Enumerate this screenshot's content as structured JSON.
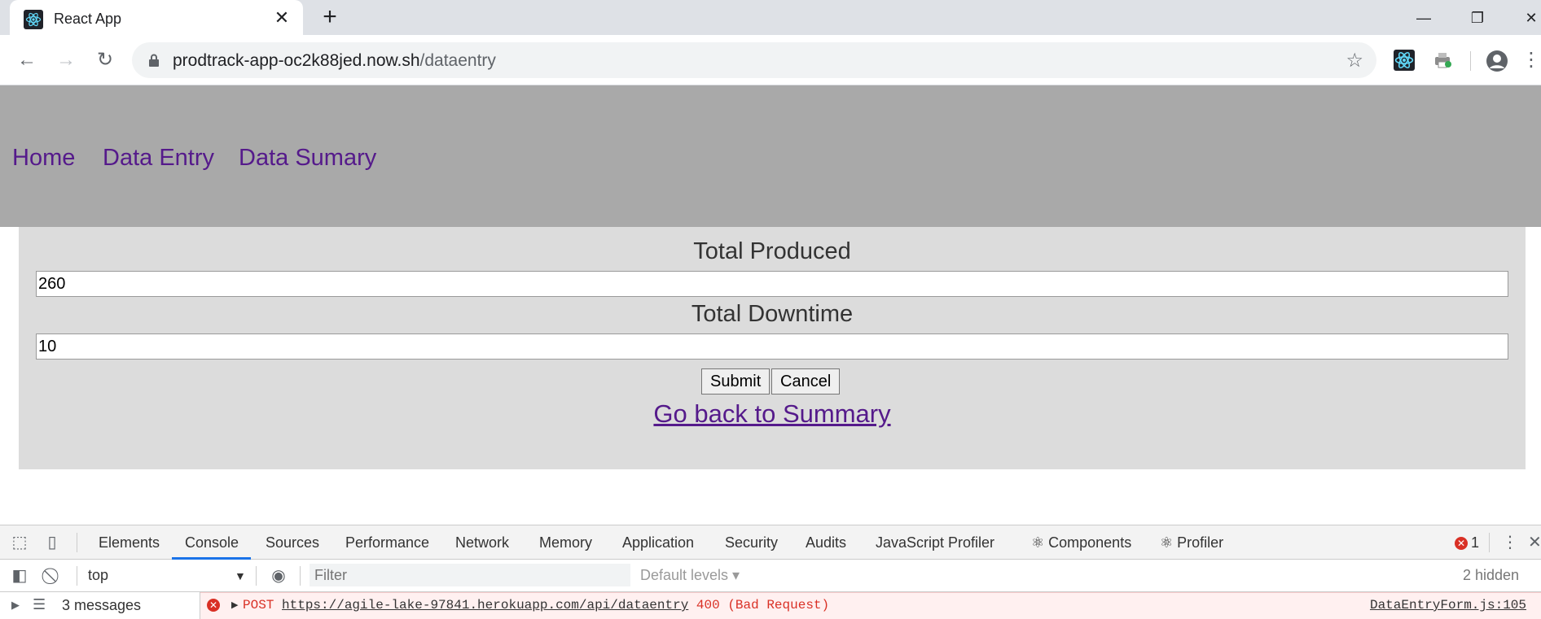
{
  "browser": {
    "tab_title": "React App",
    "url_host": "prodtrack-app-oc2k88jed.now.sh",
    "url_path": "/dataentry"
  },
  "nav": {
    "home": "Home",
    "data_entry": "Data Entry",
    "data_summary": "Data Sumary"
  },
  "form": {
    "total_produced_label": "Total Produced",
    "total_produced_value": "260",
    "total_downtime_label": "Total Downtime",
    "total_downtime_value": "10",
    "submit_label": "Submit",
    "cancel_label": "Cancel",
    "back_link": "Go back to Summary"
  },
  "devtools": {
    "tabs": [
      "Elements",
      "Console",
      "Sources",
      "Performance",
      "Network",
      "Memory",
      "Application",
      "Security",
      "Audits",
      "JavaScript Profiler",
      "⚛ Components",
      "⚛ Profiler"
    ],
    "active_tab": "Console",
    "error_count": "1",
    "context": "top",
    "filter_placeholder": "Filter",
    "levels": "Default levels ▾",
    "hidden": "2 hidden",
    "messages": "3 messages",
    "error": {
      "method": "POST",
      "url": "https://agile-lake-97841.herokuapp.com/api/dataentry",
      "status": "400 (Bad Request)",
      "source": "DataEntryForm.js:105"
    }
  },
  "colors": {
    "header_bg": "#a9a9a9",
    "panel_bg": "#dcdcdc",
    "link": "#551a8b",
    "error": "#d93025"
  }
}
